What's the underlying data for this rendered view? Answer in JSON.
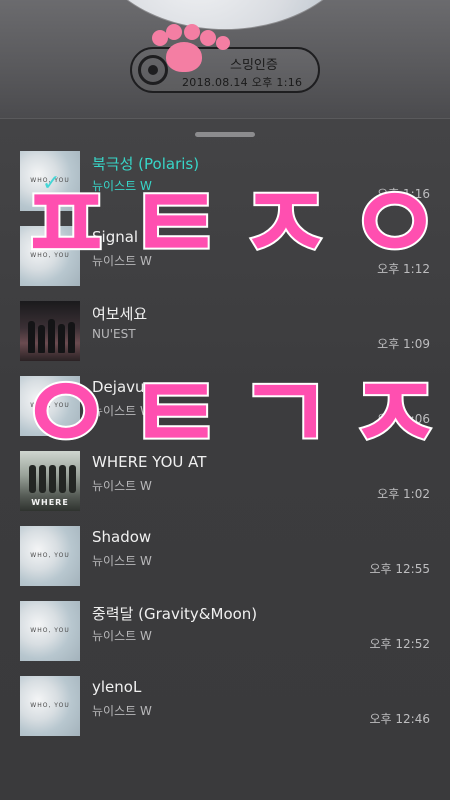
{
  "header": {
    "pill_label": "스밍인증",
    "pill_date": "2018.08.14 오후 1:16"
  },
  "songs": [
    {
      "title": "북극성 (Polaris)",
      "artist": "뉴이스트 W",
      "time": "오후 1:16",
      "thumb_text": "WHO, YOU",
      "active": true
    },
    {
      "title": "Signal",
      "artist": "뉴이스트 W",
      "time": "오후 1:12",
      "thumb_text": "WHO, YOU"
    },
    {
      "title": "여보세요",
      "artist": "NU'EST",
      "time": "오후 1:09"
    },
    {
      "title": "Dejavu",
      "artist": "뉴이스트 W",
      "time": "오후 1:06",
      "thumb_text": "WHO, YOU"
    },
    {
      "title": "WHERE YOU AT",
      "artist": "뉴이스트 W",
      "time": "오후 1:02",
      "thumb_text": "WHERE"
    },
    {
      "title": "Shadow",
      "artist": "뉴이스트 W",
      "time": "오후 12:55",
      "thumb_text": "WHO, YOU"
    },
    {
      "title": "중력달 (Gravity&Moon)",
      "artist": "뉴이스트 W",
      "time": "오후 12:52",
      "thumb_text": "WHO, YOU"
    },
    {
      "title": "ylenoL",
      "artist": "뉴이스트 W",
      "time": "오후 12:46",
      "thumb_text": "WHO, YOU"
    }
  ],
  "overlay": {
    "line1": "ㅍㅌㅈㅇ",
    "line2": "ㅇㅌㄱㅈ"
  },
  "colors": {
    "accent": "#38d6c8",
    "overlay_pink": "#ff4fb0",
    "paw_pink": "#f47ea3",
    "background": "#3a3a3c"
  },
  "icons": {
    "disc": "music-disc-icon",
    "paw": "paw-icon",
    "check": "check-icon"
  }
}
